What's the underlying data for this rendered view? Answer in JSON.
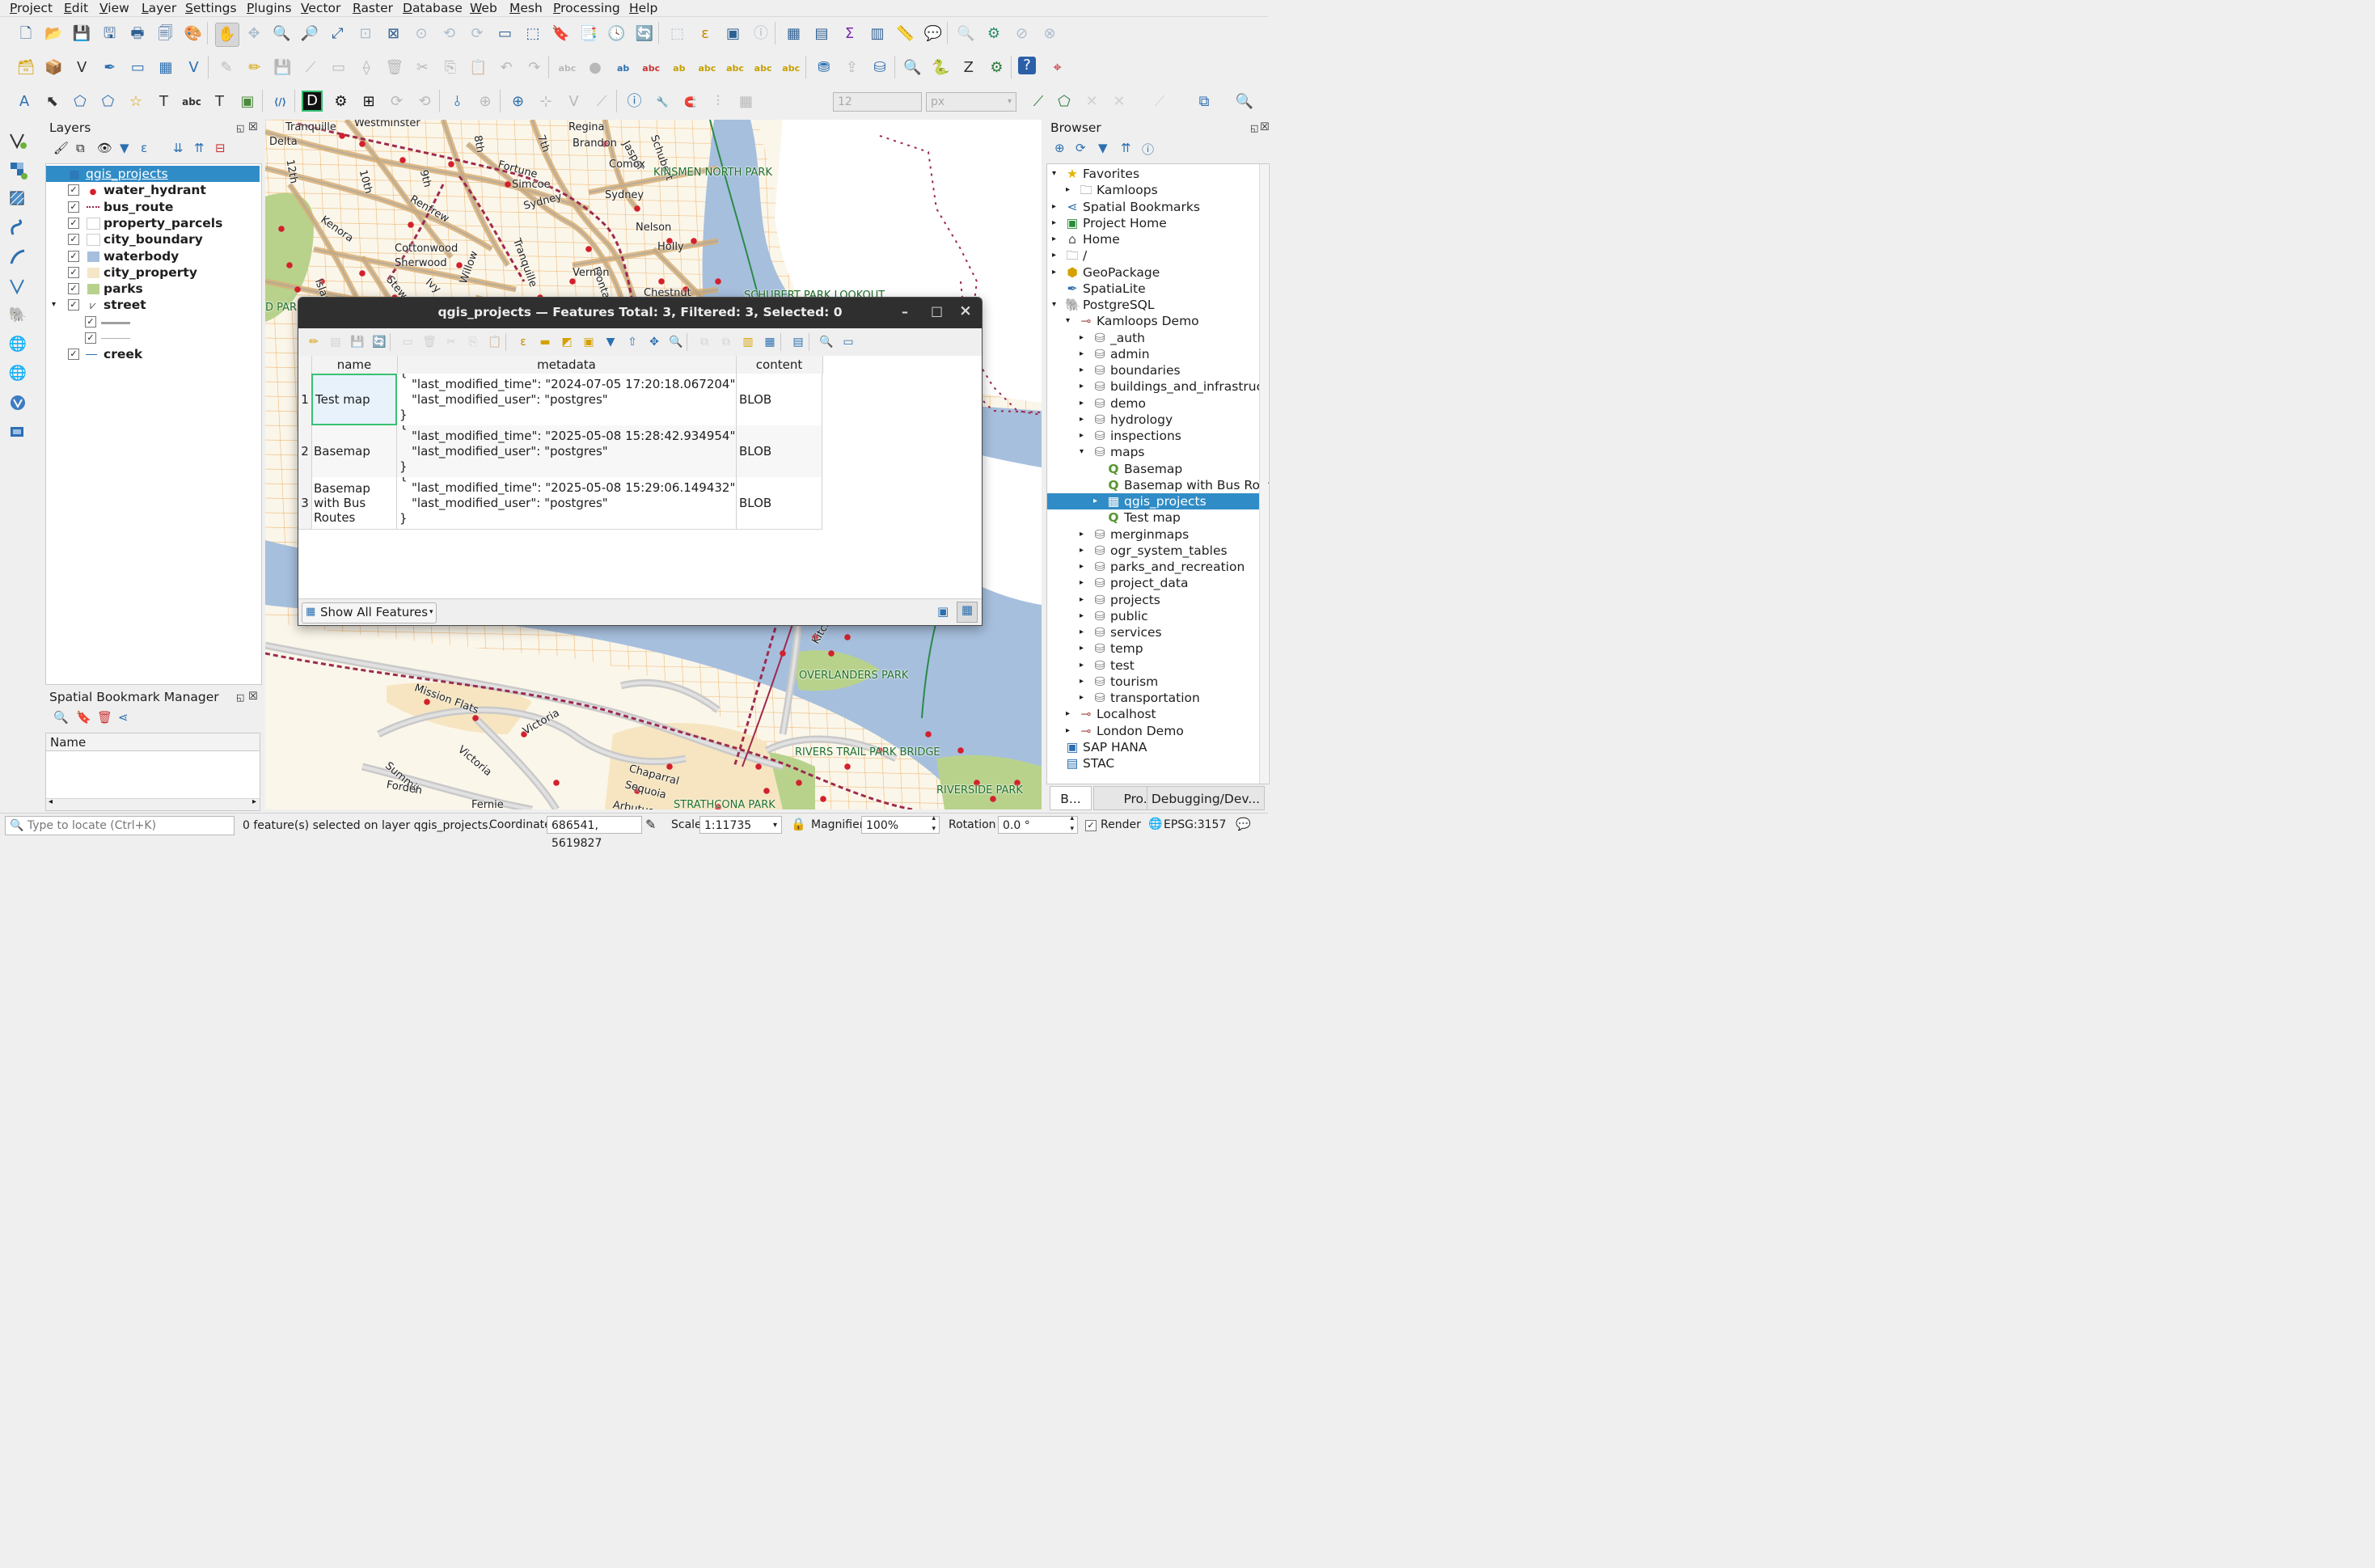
{
  "menu": [
    "Project",
    "Edit",
    "View",
    "Layer",
    "Settings",
    "Plugins",
    "Vector",
    "Raster",
    "Database",
    "Web",
    "Mesh",
    "Processing",
    "Help"
  ],
  "toolbar": {
    "row1": [
      "new-project-icon",
      "open-project-icon",
      "save-project-icon",
      "save-as-icon",
      "print-layout-icon",
      "layout-manager-icon",
      "style-manager-icon",
      "pan-icon",
      "pan-to-selection-icon",
      "zoom-in-icon",
      "zoom-out-icon",
      "zoom-full-icon",
      "zoom-to-selection-icon",
      "zoom-to-layer-icon",
      "zoom-native-icon",
      "zoom-last-icon",
      "zoom-next-icon",
      "new-map-view-icon",
      "new-3d-view-icon",
      "bookmark-add-icon",
      "bookmarks-icon",
      "temporal-icon",
      "refresh-icon",
      "select-features-icon",
      "select-by-expression-icon",
      "deselect-icon",
      "identify-icon",
      "attribute-table-icon",
      "field-calculator-icon",
      "stats-icon",
      "open-table-icon",
      "measure-icon",
      "annotation-icon",
      "zoom-to-icon",
      "processing-toolbox-icon",
      "deselect-all-icon",
      "clear-icon"
    ],
    "snap_tolerance": "12",
    "snap_unit": "px"
  },
  "layers_panel": {
    "title": "Layers",
    "items": [
      {
        "name": "qgis_projects",
        "checked": null,
        "icon": "table-icon",
        "bold": false,
        "selected": true
      },
      {
        "name": "water_hydrant",
        "checked": true,
        "icon": "point-symbol-icon",
        "bold": true
      },
      {
        "name": "bus_route",
        "checked": true,
        "icon": "dotted-line-icon",
        "bold": true
      },
      {
        "name": "property_parcels",
        "checked": true,
        "icon": "polygon-white-icon",
        "bold": true
      },
      {
        "name": "city_boundary",
        "checked": true,
        "icon": "polygon-white-icon",
        "bold": true
      },
      {
        "name": "waterbody",
        "checked": true,
        "icon": "polygon-blue-icon",
        "bold": true
      },
      {
        "name": "city_property",
        "checked": true,
        "icon": "polygon-beige-icon",
        "bold": true
      },
      {
        "name": "parks",
        "checked": true,
        "icon": "polygon-green-icon",
        "bold": true
      },
      {
        "name": "street",
        "checked": true,
        "icon": "line-style-icon",
        "bold": true
      }
    ],
    "street_children": [
      true,
      true
    ],
    "creek": {
      "name": "creek",
      "checked": true
    }
  },
  "bookmark_panel": {
    "title": "Spatial Bookmark Manager",
    "column": "Name"
  },
  "browser_panel": {
    "title": "Browser",
    "items": [
      {
        "label": "Favorites",
        "indent": 0,
        "expanded": true,
        "icon": "star-icon"
      },
      {
        "label": "Kamloops",
        "indent": 1,
        "expanded": false,
        "icon": "folder-icon"
      },
      {
        "label": "Spatial Bookmarks",
        "indent": 0,
        "expanded": false,
        "icon": "bookmark-folder-icon"
      },
      {
        "label": "Project Home",
        "indent": 0,
        "expanded": false,
        "icon": "project-home-icon"
      },
      {
        "label": "Home",
        "indent": 0,
        "expanded": false,
        "icon": "home-icon"
      },
      {
        "label": "/",
        "indent": 0,
        "expanded": false,
        "icon": "folder-icon"
      },
      {
        "label": "GeoPackage",
        "indent": 0,
        "expanded": false,
        "icon": "geopackage-icon"
      },
      {
        "label": "SpatiaLite",
        "indent": 0,
        "expanded": null,
        "icon": "spatialite-icon"
      },
      {
        "label": "PostgreSQL",
        "indent": 0,
        "expanded": true,
        "icon": "postgresql-icon"
      },
      {
        "label": "Kamloops Demo",
        "indent": 1,
        "expanded": true,
        "icon": "connection-icon"
      },
      {
        "label": "_auth",
        "indent": 2,
        "expanded": false,
        "icon": "schema-icon"
      },
      {
        "label": "admin",
        "indent": 2,
        "expanded": false,
        "icon": "schema-icon"
      },
      {
        "label": "boundaries",
        "indent": 2,
        "expanded": false,
        "icon": "schema-icon"
      },
      {
        "label": "buildings_and_infrastruct",
        "indent": 2,
        "expanded": false,
        "icon": "schema-icon"
      },
      {
        "label": "demo",
        "indent": 2,
        "expanded": false,
        "icon": "schema-icon"
      },
      {
        "label": "hydrology",
        "indent": 2,
        "expanded": false,
        "icon": "schema-icon"
      },
      {
        "label": "inspections",
        "indent": 2,
        "expanded": false,
        "icon": "schema-icon"
      },
      {
        "label": "maps",
        "indent": 2,
        "expanded": true,
        "icon": "schema-icon"
      },
      {
        "label": "Basemap",
        "indent": 3,
        "expanded": null,
        "icon": "qgis-project-icon"
      },
      {
        "label": "Basemap with Bus Rout",
        "indent": 3,
        "expanded": null,
        "icon": "qgis-project-icon"
      },
      {
        "label": "qgis_projects",
        "indent": 3,
        "expanded": false,
        "icon": "table-icon",
        "selected": true
      },
      {
        "label": "Test map",
        "indent": 3,
        "expanded": null,
        "icon": "qgis-project-icon"
      },
      {
        "label": "merginmaps",
        "indent": 2,
        "expanded": false,
        "icon": "schema-icon"
      },
      {
        "label": "ogr_system_tables",
        "indent": 2,
        "expanded": false,
        "icon": "schema-icon"
      },
      {
        "label": "parks_and_recreation",
        "indent": 2,
        "expanded": false,
        "icon": "schema-icon"
      },
      {
        "label": "project_data",
        "indent": 2,
        "expanded": false,
        "icon": "schema-icon"
      },
      {
        "label": "projects",
        "indent": 2,
        "expanded": false,
        "icon": "schema-icon"
      },
      {
        "label": "public",
        "indent": 2,
        "expanded": false,
        "icon": "schema-icon"
      },
      {
        "label": "services",
        "indent": 2,
        "expanded": false,
        "icon": "schema-icon"
      },
      {
        "label": "temp",
        "indent": 2,
        "expanded": false,
        "icon": "schema-icon"
      },
      {
        "label": "test",
        "indent": 2,
        "expanded": false,
        "icon": "schema-icon"
      },
      {
        "label": "tourism",
        "indent": 2,
        "expanded": false,
        "icon": "schema-icon"
      },
      {
        "label": "transportation",
        "indent": 2,
        "expanded": false,
        "icon": "schema-icon"
      },
      {
        "label": "Localhost",
        "indent": 1,
        "expanded": false,
        "icon": "connection-icon"
      },
      {
        "label": "London Demo",
        "indent": 1,
        "expanded": false,
        "icon": "connection-icon"
      },
      {
        "label": "SAP HANA",
        "indent": 0,
        "expanded": null,
        "icon": "sap-hana-icon"
      },
      {
        "label": "STAC",
        "indent": 0,
        "expanded": null,
        "icon": "stac-icon"
      }
    ],
    "tabs": [
      "B...",
      "Pro...",
      "Debugging/Dev..."
    ]
  },
  "map_labels": [
    "Tranquille",
    "Westminster",
    "Regina",
    "Delta",
    "Brandon",
    "Jasper",
    "Schubert",
    "8th",
    "7th",
    "KINSMEN NORTH PARK",
    "Fortune",
    "Comox",
    "12th",
    "10th",
    "9th",
    "Simcoe",
    "Sydney",
    "Renfrew",
    "Sydney",
    "Kenora",
    "Nelson",
    "Cottonwood",
    "Tranquille",
    "Holly",
    "Sherwood",
    "Frontage",
    "Island",
    "Ivy",
    "Stewart",
    "Willow",
    "Vernon",
    "Chestnut",
    "SCHUBERT PARK LOOKOUT",
    "D PAR",
    "Kitch",
    "OVERLANDERS PARK",
    "Mission Flats",
    "Victoria",
    "Victoria",
    "Summit",
    "RIVERS TRAIL PARK BRIDGE",
    "Chaparral",
    "Sequoia",
    "Forden",
    "Fernie",
    "Arbutus",
    "RIVERSIDE PARK",
    "STRATHCONA PARK"
  ],
  "attribute_table": {
    "title": "qgis_projects — Features Total: 3, Filtered: 3, Selected: 0",
    "columns": [
      "name",
      "metadata",
      "content"
    ],
    "rows": [
      {
        "id": "1",
        "name": "Test map",
        "meta_time": "\"last_modified_time\": \"2024-07-05 17:20:18.067204\",",
        "meta_user": "\"last_modified_user\": \"postgres\"",
        "content": "BLOB"
      },
      {
        "id": "2",
        "name": "Basemap",
        "meta_time": "\"last_modified_time\": \"2025-05-08 15:28:42.934954\",",
        "meta_user": "\"last_modified_user\": \"postgres\"",
        "content": "BLOB"
      },
      {
        "id": "3",
        "name": "Basemap with Bus Routes",
        "meta_time": "\"last_modified_time\": \"2025-05-08 15:29:06.149432\",",
        "meta_user": "\"last_modified_user\": \"postgres\"",
        "content": "BLOB"
      }
    ],
    "brace_open": "{",
    "brace_close": "}",
    "filter_button": "Show All Features",
    "window_controls": [
      "–",
      "□",
      "×"
    ]
  },
  "status": {
    "locator_placeholder": "Type to locate (Ctrl+K)",
    "message": "0 feature(s) selected on layer qgis_projects.",
    "coordinate_label": "Coordinate",
    "coordinate": "686541, 5619827",
    "scale_label": "Scale",
    "scale": "1:11735",
    "magnifier_label": "Magnifier",
    "magnifier": "100%",
    "rotation_label": "Rotation",
    "rotation": "0.0 °",
    "render_label": "Render",
    "render_checked": true,
    "crs": "EPSG:3157"
  },
  "colors": {
    "selection": "#308cc6",
    "water": "#a6bfdd",
    "park": "#b8d28c",
    "road": "#d7ae74",
    "parcel": "#e89b3b",
    "hydrant": "#d3202c",
    "bus_route": "#9d2a4f"
  }
}
